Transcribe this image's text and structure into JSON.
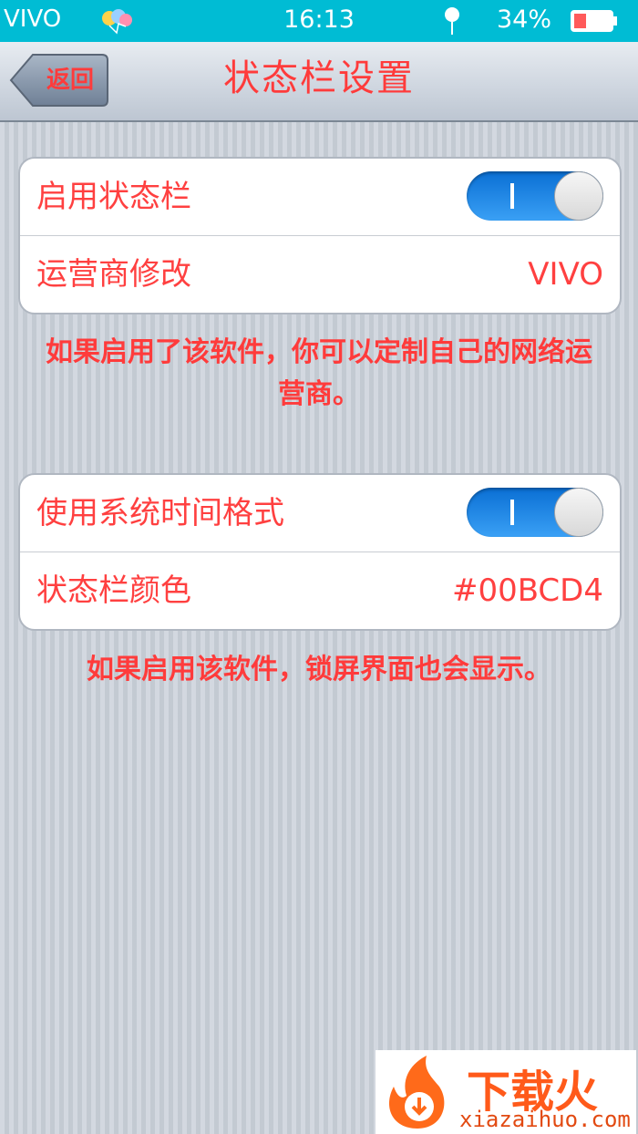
{
  "status_bar": {
    "carrier": "VIVO",
    "time": "16:13",
    "battery_percent": "34%",
    "battery_level": 0.34,
    "background_color": "#00BCD4",
    "icons": [
      "balloon-icon",
      "location-pin-icon",
      "battery-icon"
    ]
  },
  "nav": {
    "back_label": "返回",
    "title": "状态栏设置"
  },
  "group1": {
    "rows": [
      {
        "label": "启用状态栏",
        "type": "toggle",
        "on": true
      },
      {
        "label": "运营商修改",
        "value": "VIVO"
      }
    ],
    "note": "如果启用了该软件，你可以定制自己的网络运营商。"
  },
  "group2": {
    "rows": [
      {
        "label": "使用系统时间格式",
        "type": "toggle",
        "on": true
      },
      {
        "label": "状态栏颜色",
        "value": "#00BCD4"
      }
    ],
    "note": "如果启用该软件，锁屏界面也会显示。"
  },
  "colors": {
    "accent_text": "#ff3b3b",
    "toggle_on": "#1a84e8"
  },
  "watermark": {
    "brand": "下载火",
    "url": "xiazaihuo.com"
  }
}
